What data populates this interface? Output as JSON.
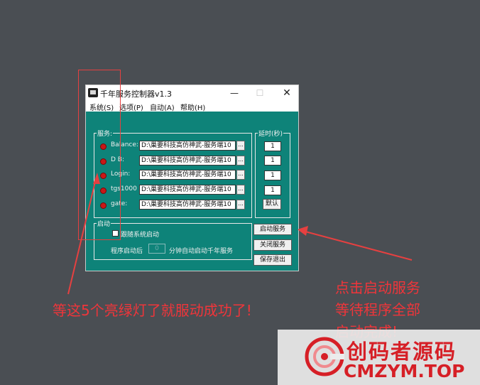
{
  "window": {
    "title": "千年服务控制器v1.3",
    "minimize_glyph": "—",
    "maximize_glyph": "☐",
    "close_glyph": "✕"
  },
  "menu": [
    "系统(S)",
    "选项(P)",
    "自动(A)",
    "帮助(H)"
  ],
  "services_group": {
    "title": "服务:",
    "rows": [
      {
        "label": "Balance:",
        "path": "D:\\巢要科技高仿神武-服务端10",
        "led_color": "#c81818"
      },
      {
        "label": "D B:",
        "path": "D:\\巢要科技高仿神武-服务端10",
        "led_color": "#c81818"
      },
      {
        "label": "Login:",
        "path": "D:\\巢要科技高仿神武-服务端10",
        "led_color": "#c81818"
      },
      {
        "label": "tgs1000",
        "path": "D:\\巢要科技高仿神武-服务端10",
        "led_color": "#c81818"
      },
      {
        "label": "gate:",
        "path": "D:\\巢要科技高仿神武-服务端10",
        "led_color": "#c81818"
      }
    ],
    "browse_label": "..."
  },
  "delay_group": {
    "title": "延时(秒)",
    "values": [
      "1",
      "1",
      "1",
      "1"
    ],
    "default_button": "默认"
  },
  "autostart_group": {
    "title": "启动",
    "checkbox_label": "跟随系统启动",
    "schedule_prefix": "程序启动后",
    "schedule_minutes": "0",
    "schedule_suffix": "分钟自动启动千年服务"
  },
  "buttons": {
    "start": "启动服务",
    "stop": "关闭服务",
    "save_exit": "保存退出"
  },
  "annotations": {
    "left_note": "等这5个亮绿灯了就服动成功了!",
    "right_note_line1": "点击启动服务",
    "right_note_line2": "等待程序全部",
    "right_note_line3": "启动完成!",
    "color": "#f0353a"
  },
  "watermark": {
    "line1": "创码者源码",
    "line2": "CMZYM.TOP",
    "color": "#d61f26"
  },
  "colors": {
    "client_bg": "#0e8379",
    "desktop_bg": "#4a4e53"
  }
}
